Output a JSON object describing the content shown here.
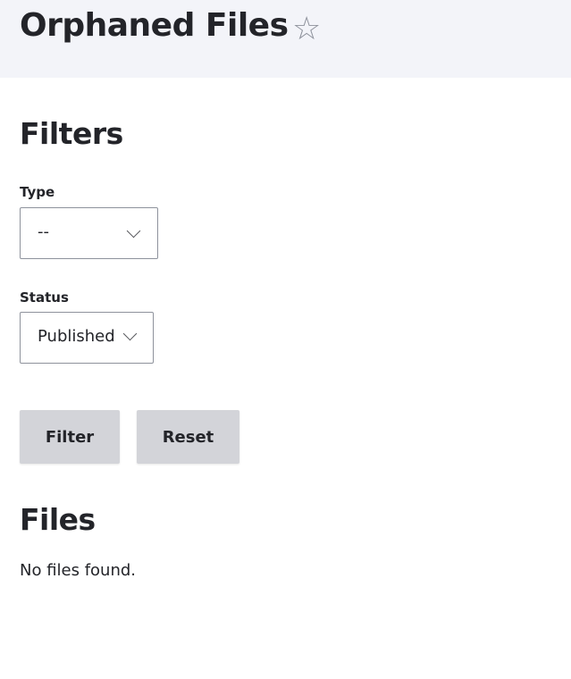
{
  "header": {
    "title": "Orphaned Files",
    "star_icon": "star-outline-icon"
  },
  "filters": {
    "heading": "Filters",
    "type": {
      "label": "Type",
      "value": "--"
    },
    "status": {
      "label": "Status",
      "value": "Published"
    },
    "filter_button": "Filter",
    "reset_button": "Reset"
  },
  "files": {
    "heading": "Files",
    "empty_message": "No files found."
  }
}
